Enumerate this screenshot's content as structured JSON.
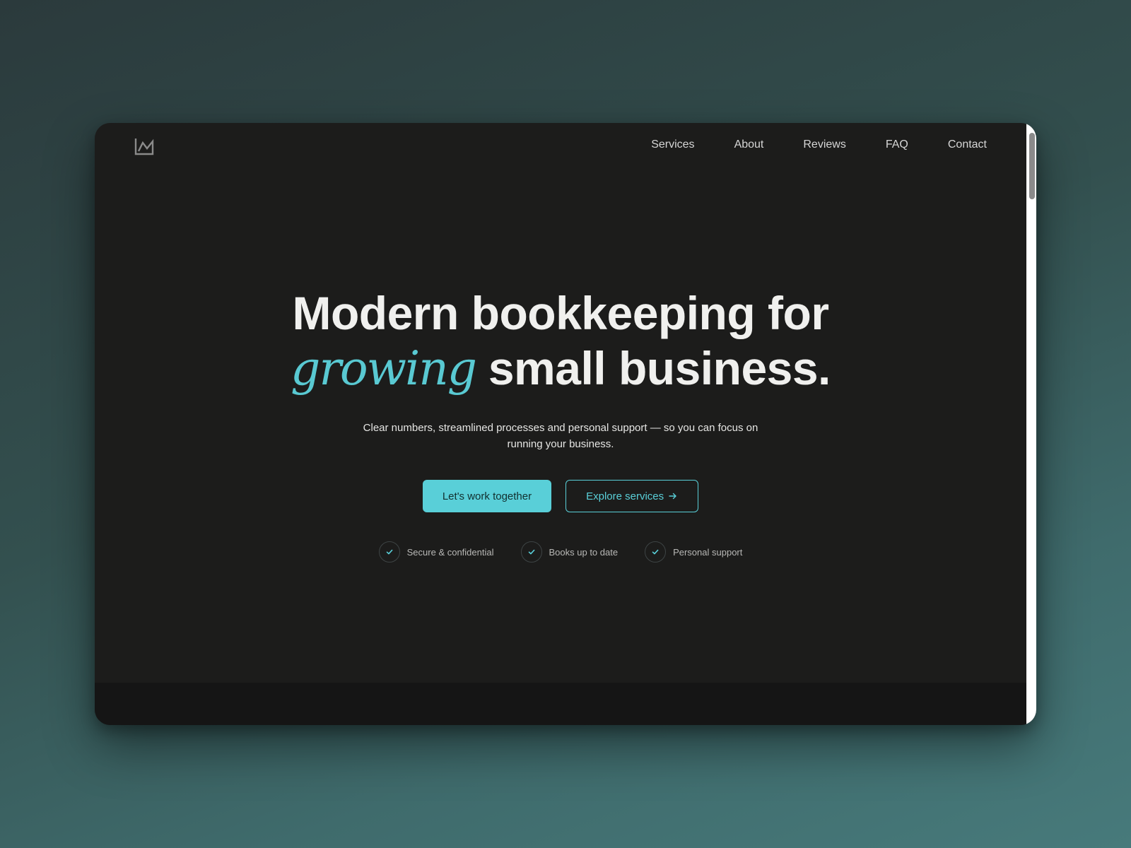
{
  "nav": {
    "logo_icon": "monogram-logo-icon",
    "links": [
      {
        "label": "Services"
      },
      {
        "label": "About"
      },
      {
        "label": "Reviews"
      },
      {
        "label": "FAQ"
      },
      {
        "label": "Contact"
      }
    ]
  },
  "hero": {
    "headline_line1": "Modern bookkeeping for",
    "headline_accent": "growing",
    "headline_line2_rest": "small business.",
    "subtitle": "Clear numbers, streamlined processes and personal support — so you can focus on running your business.",
    "primary_cta": "Let's work together",
    "secondary_cta": "Explore services",
    "secondary_cta_icon": "arrow-right-icon"
  },
  "features": [
    {
      "label": "Secure & confidential",
      "icon": "check-icon"
    },
    {
      "label": "Books up to date",
      "icon": "check-icon"
    },
    {
      "label": "Personal support",
      "icon": "check-icon"
    }
  ],
  "colors": {
    "accent": "#59cfd8",
    "page_background": "#1c1c1b",
    "headline_text": "#f0f0ee"
  }
}
